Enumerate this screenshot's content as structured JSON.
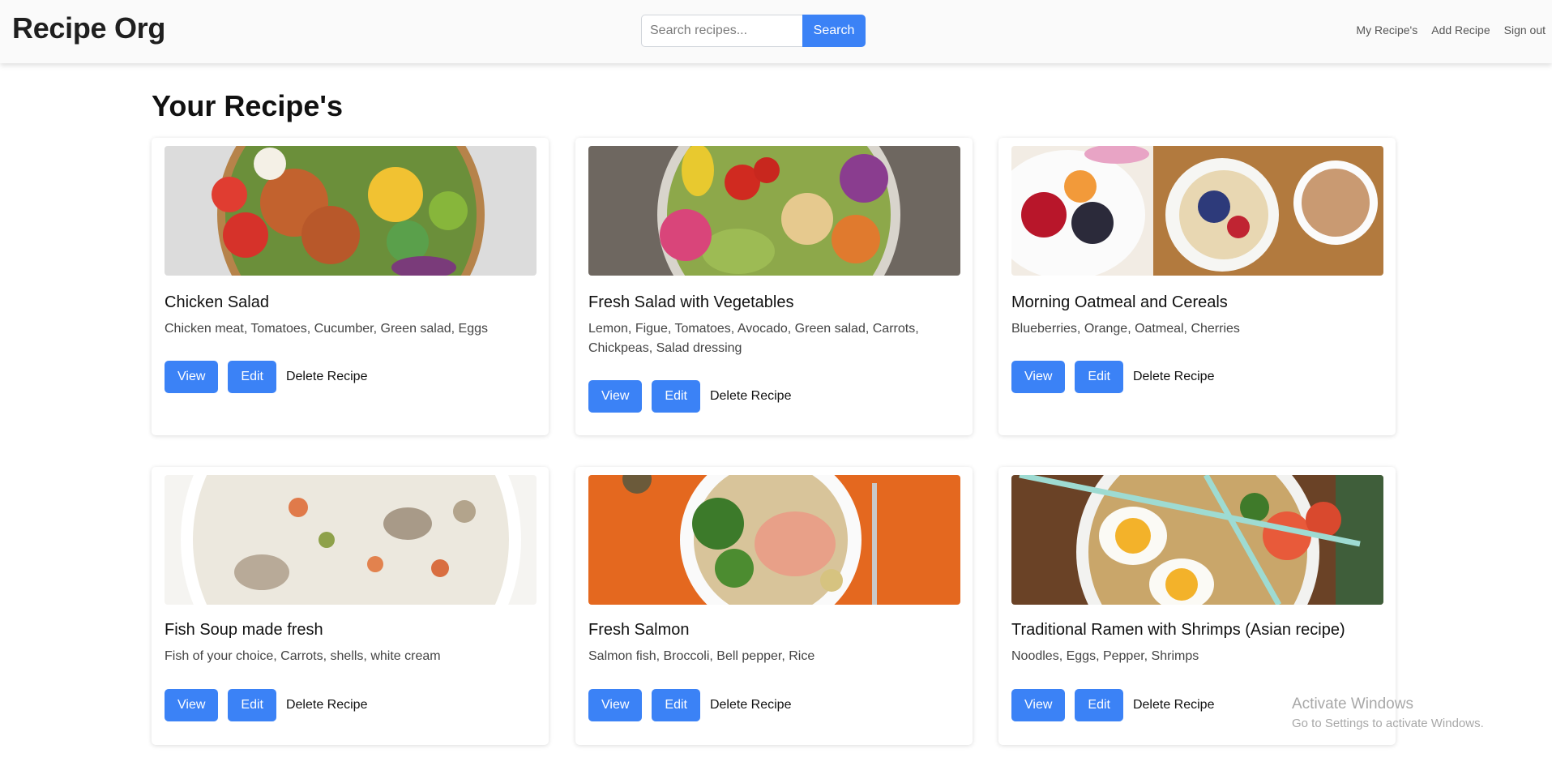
{
  "app": {
    "brand": "Recipe Org"
  },
  "search": {
    "placeholder": "Search recipes...",
    "button_label": "Search"
  },
  "nav": {
    "links": [
      "My Recipe's",
      "Add Recipe",
      "Sign out"
    ]
  },
  "main": {
    "title": "Your Recipe's"
  },
  "actions": {
    "view": "View",
    "edit": "Edit",
    "delete": "Delete Recipe"
  },
  "recipes": [
    {
      "title": "Chicken Salad",
      "ingredients": "Chicken meat, Tomatoes, Cucumber, Green salad, Eggs",
      "image": "chicken-salad-bowl"
    },
    {
      "title": "Fresh Salad with Vegetables",
      "ingredients": "Lemon, Figue, Tomatoes, Avocado, Green salad, Carrots, Chickpeas, Salad dressing",
      "image": "vegetable-salad-bowl"
    },
    {
      "title": "Morning Oatmeal and Cereals",
      "ingredients": "Blueberries, Orange, Oatmeal, Cherries",
      "image": "oatmeal-breakfast"
    },
    {
      "title": "Fish Soup made fresh",
      "ingredients": "Fish of your choice, Carrots, shells, white cream",
      "image": "clam-chowder"
    },
    {
      "title": "Fresh Salmon",
      "ingredients": "Salmon fish, Broccoli, Bell pepper, Rice",
      "image": "salmon-plate"
    },
    {
      "title": "Traditional Ramen with Shrimps (Asian recipe)",
      "ingredients": "Noodles, Eggs, Pepper, Shrimps",
      "image": "ramen-bowl"
    }
  ],
  "watermark": {
    "title": "Activate Windows",
    "subtitle": "Go to Settings to activate Windows."
  },
  "colors": {
    "primary": "#3b82f6",
    "navbar_bg": "#fafafa"
  }
}
